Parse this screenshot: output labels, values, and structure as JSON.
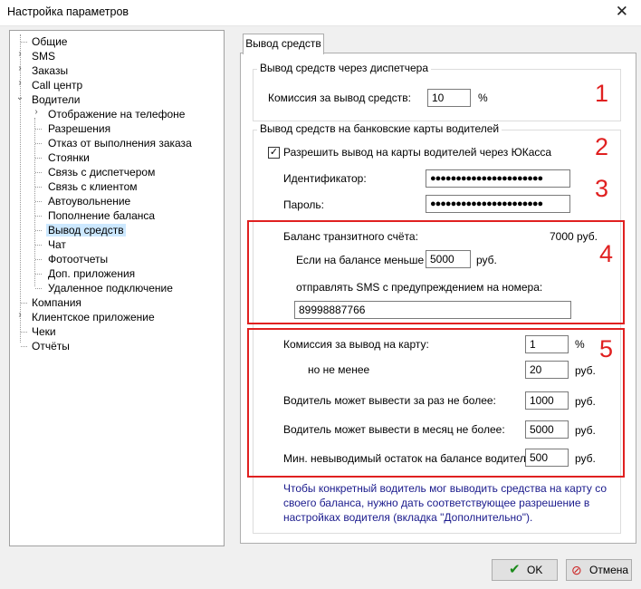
{
  "window": {
    "title": "Настройка параметров"
  },
  "tree": {
    "items": [
      {
        "label": "Общие"
      },
      {
        "label": "SMS"
      },
      {
        "label": "Заказы"
      },
      {
        "label": "Call центр"
      },
      {
        "label": "Водители"
      },
      {
        "label": "Отображение на телефоне"
      },
      {
        "label": "Разрешения"
      },
      {
        "label": "Отказ от выполнения заказа"
      },
      {
        "label": "Стоянки"
      },
      {
        "label": "Связь с диспетчером"
      },
      {
        "label": "Связь с клиентом"
      },
      {
        "label": "Автоувольнение"
      },
      {
        "label": "Пополнение баланса"
      },
      {
        "label": "Вывод средств"
      },
      {
        "label": "Чат"
      },
      {
        "label": "Фотоотчеты"
      },
      {
        "label": "Доп. приложения"
      },
      {
        "label": "Удаленное подключение"
      },
      {
        "label": "Компания"
      },
      {
        "label": "Клиентское приложение"
      },
      {
        "label": "Чеки"
      },
      {
        "label": "Отчёты"
      }
    ]
  },
  "tab": {
    "label": "Вывод средств"
  },
  "dispatcher": {
    "title": "Вывод средств через диспетчера",
    "commission_label": "Комиссия за вывод средств:",
    "commission_value": "10",
    "percent": "%"
  },
  "bank": {
    "title": "Вывод средств на банковские карты водителей",
    "allow_label": "Разрешить вывод на карты водителей через ЮКасса",
    "allow_check": "✓",
    "id_label": "Идентификатор:",
    "id_value": "●●●●●●●●●●●●●●●●●●●●●●",
    "pwd_label": "Пароль:",
    "pwd_value": "●●●●●●●●●●●●●●●●●●●●●●",
    "balance_label": "Баланс транзитного счёта:",
    "balance_value": "7000 руб.",
    "if_less_label": "Если на балансе меньше",
    "if_less_value": "5000",
    "rub": "руб.",
    "sms_label": "отправлять SMS с предупреждением на номера:",
    "sms_value": "89998887766",
    "card_commission_label": "Комиссия за вывод на карту:",
    "card_commission_value": "1",
    "min_label": "но не менее",
    "min_value": "20",
    "once_label": "Водитель может вывести за раз не более:",
    "once_value": "1000",
    "month_label": "Водитель может вывести в месяц не более:",
    "month_value": "5000",
    "rest_label": "Мин. невыводимый остаток на балансе водителя:",
    "rest_value": "500",
    "note_lines": [
      "Чтобы конкретный водитель мог выводить средства на карту со",
      "своего баланса, нужно дать соответствующее разрешение в",
      "настройках водителя (вкладка \"Дополнительно\")."
    ]
  },
  "annotations": [
    "1",
    "2",
    "3",
    "4",
    "5"
  ],
  "buttons": {
    "ok": "OK",
    "cancel": "Отмена",
    "ok_icon": "check-icon",
    "cancel_icon": "forbid-icon"
  },
  "colors": {
    "annotation": "#e02020",
    "note": "#1a1a8c",
    "selection": "#cce8ff"
  }
}
